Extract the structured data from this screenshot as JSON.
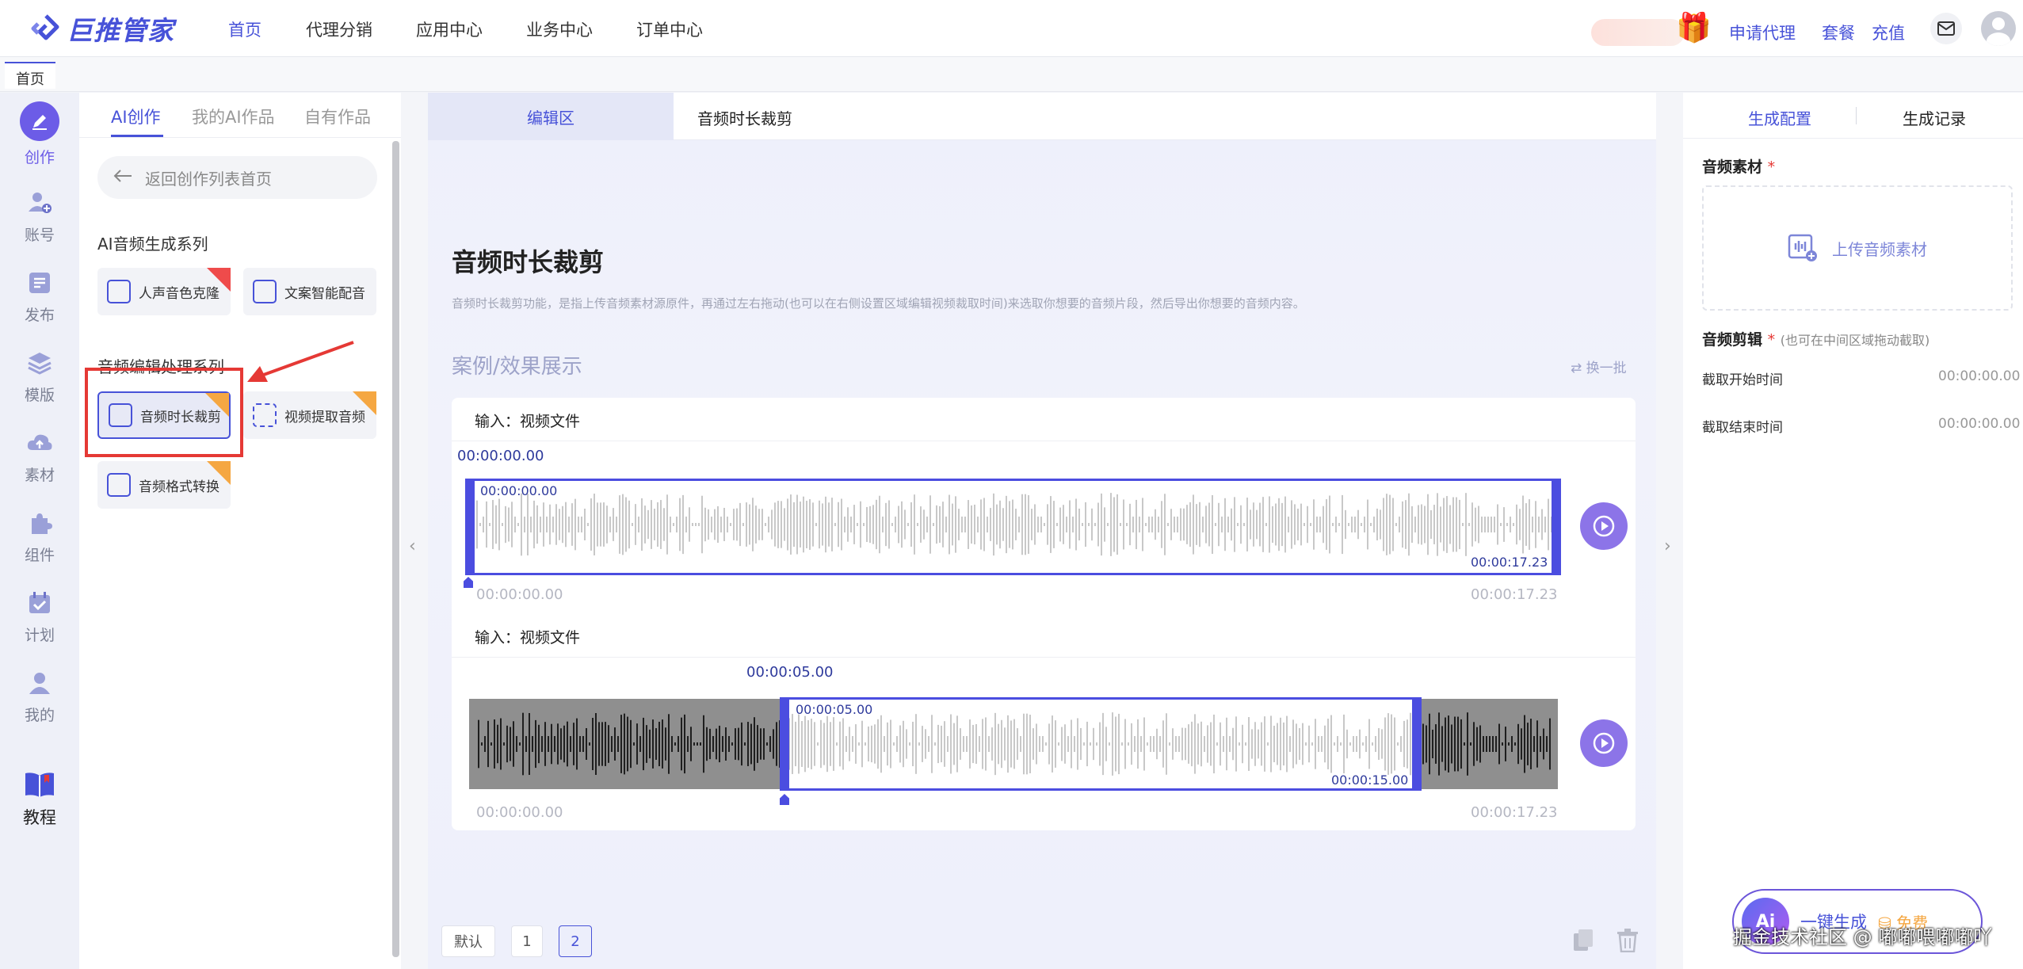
{
  "brand": {
    "name": "巨推管家",
    "color": "#4752d8"
  },
  "nav": {
    "items": [
      {
        "label": "首页",
        "active": true
      },
      {
        "label": "代理分销",
        "active": false
      },
      {
        "label": "应用中心",
        "active": false
      },
      {
        "label": "业务中心",
        "active": false
      },
      {
        "label": "订单中心",
        "active": false
      }
    ],
    "right_links": [
      "申请代理",
      "套餐",
      "充值"
    ]
  },
  "tabstrip": {
    "home": "首页"
  },
  "rail": [
    {
      "label": "创作",
      "icon": "pen-icon",
      "active": true
    },
    {
      "label": "账号",
      "icon": "user-add-icon",
      "active": false
    },
    {
      "label": "发布",
      "icon": "publish-icon",
      "active": false
    },
    {
      "label": "模版",
      "icon": "layers-icon",
      "active": false
    },
    {
      "label": "素材",
      "icon": "cloud-upload-icon",
      "active": false
    },
    {
      "label": "组件",
      "icon": "puzzle-icon",
      "active": false
    },
    {
      "label": "计划",
      "icon": "calendar-check-icon",
      "active": false
    },
    {
      "label": "我的",
      "icon": "profile-icon",
      "active": false
    },
    {
      "label": "教程",
      "icon": "book-icon",
      "active": false
    }
  ],
  "left": {
    "tabs": [
      "AI创作",
      "我的AI作品",
      "自有作品"
    ],
    "back": "返回创作列表首页",
    "section1": "AI音频生成系列",
    "section2": "音频编辑处理系列",
    "tools1": [
      "人声音色克隆",
      "文案智能配音"
    ],
    "tools2": [
      "音频时长裁剪",
      "视频提取音频",
      "音频格式转换"
    ]
  },
  "center": {
    "tabs": [
      "编辑区",
      "音频时长裁剪"
    ],
    "title": "音频时长裁剪",
    "desc": "音频时长裁剪功能，是指上传音频素材源原件，再通过左右拖动(也可以在右侧设置区域编辑视频裁取时间)来选取你想要的音频片段，然后导出你想要的音频内容。",
    "case_title": "案例/效果展示",
    "refresh": "换一批",
    "example1": {
      "input_label": "输入：视频文件",
      "cursor_time": "00:00:00.00",
      "sel_start": "00:00:00.00",
      "sel_end": "00:00:17.23",
      "axis_start": "00:00:00.00",
      "axis_end": "00:00:17.23",
      "selection_fraction": [
        0,
        1
      ]
    },
    "example2": {
      "input_label": "输入：视频文件",
      "cursor_time": "00:00:05.00",
      "sel_start": "00:00:05.00",
      "sel_end": "00:00:15.00",
      "axis_start": "00:00:00.00",
      "axis_end": "00:00:17.23",
      "selection_fraction": [
        0.29,
        0.87
      ]
    },
    "pagination": {
      "default_label": "默认",
      "pages": [
        "1",
        "2"
      ],
      "current": "2"
    }
  },
  "right": {
    "tabs": [
      "生成配置",
      "生成记录"
    ],
    "material_label": "音频素材",
    "upload_label": "上传音频素材",
    "clip_label": "音频剪辑",
    "clip_hint": "(也可在中间区域拖动截取)",
    "start_label": "截取开始时间",
    "start_value": "00:00:00.00",
    "end_label": "截取结束时间",
    "end_value": "00:00:00.00",
    "generate_label": "一键生成",
    "free_label": "免费",
    "ai_badge": "Ai"
  },
  "watermark": "掘金技术社区 @ 嘟嘟喂嘟嘟吖"
}
